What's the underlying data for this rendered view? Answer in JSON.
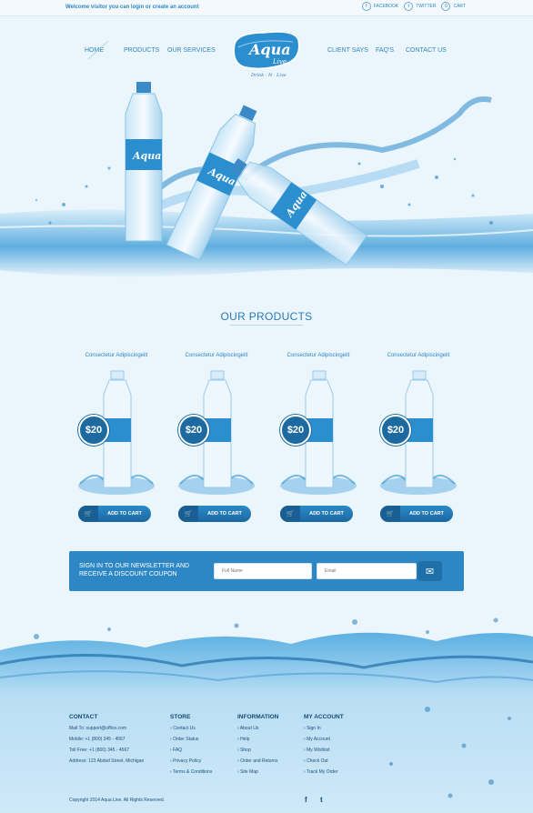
{
  "topbar": {
    "welcome": "Welcome visitor you can login or create an account",
    "links": [
      {
        "label": "FACEBOOK",
        "icon": "facebook-icon",
        "glyph": "f"
      },
      {
        "label": "TWITTER",
        "icon": "twitter-icon",
        "glyph": "t"
      },
      {
        "label": "CART",
        "icon": "cart-count-icon",
        "glyph": "0"
      }
    ]
  },
  "nav": {
    "items": [
      "HOME",
      "PRODUCTS",
      "OUR SERVICES",
      "CLIENT SAYS",
      "FAQ'S",
      "CONTACT US"
    ]
  },
  "logo": {
    "name": "Aqua",
    "sub": "Live",
    "tagline": "Drink · N · Live"
  },
  "hero": {
    "bottle_label": "Aqua"
  },
  "products": {
    "title": "OUR PRODUCTS",
    "items": [
      {
        "name": "Consectetur Adipiscingelit",
        "price": "$20",
        "button": "ADD TO CART"
      },
      {
        "name": "Consectetur Adipiscingelit",
        "price": "$20",
        "button": "ADD TO CART"
      },
      {
        "name": "Consectetur Adipiscingelit",
        "price": "$20",
        "button": "ADD TO CART"
      },
      {
        "name": "Consectetur Adipiscingelit",
        "price": "$20",
        "button": "ADD TO CART"
      }
    ]
  },
  "newsletter": {
    "text": "SIGN IN TO OUR NEWSLETTER AND RECEIVE A DISCOUNT COUPON",
    "fullname_placeholder": "Full Name",
    "email_placeholder": "Email",
    "send_icon": "envelope-icon"
  },
  "footer": {
    "contact": {
      "title": "CONTACT",
      "rows": [
        {
          "label": "Mail To:",
          "value": "support@office.com"
        },
        {
          "label": "Mobile:",
          "value": "+1 (800) 345 - 4567"
        },
        {
          "label": "Toll Free:",
          "value": "+1 (800) 345 - 4567"
        },
        {
          "label": "Address:",
          "value": "123 Abdsd Street, Michigan"
        }
      ]
    },
    "store": {
      "title": "STORE",
      "links": [
        "Contact Us",
        "Order Status",
        "FAQ",
        "Privacy Policy",
        "Terms & Conditions"
      ]
    },
    "information": {
      "title": "INFORMATION",
      "links": [
        "About Us",
        "Help",
        "Shop",
        "Order and Returns",
        "Site Map"
      ]
    },
    "account": {
      "title": "MY ACCOUNT",
      "links": [
        "Sign In",
        "My Account",
        "My Wishlist",
        "Check Out",
        "Track My Order"
      ]
    },
    "copyright": "Copyright 2014 Aqua Live. All Rights Reserved.",
    "social": [
      {
        "glyph": "f",
        "icon": "facebook-icon"
      },
      {
        "glyph": "t",
        "icon": "twitter-icon"
      }
    ]
  },
  "colors": {
    "accent": "#2d87c5",
    "dark_blue": "#1d6aa1",
    "background": "#eaf5fc"
  }
}
